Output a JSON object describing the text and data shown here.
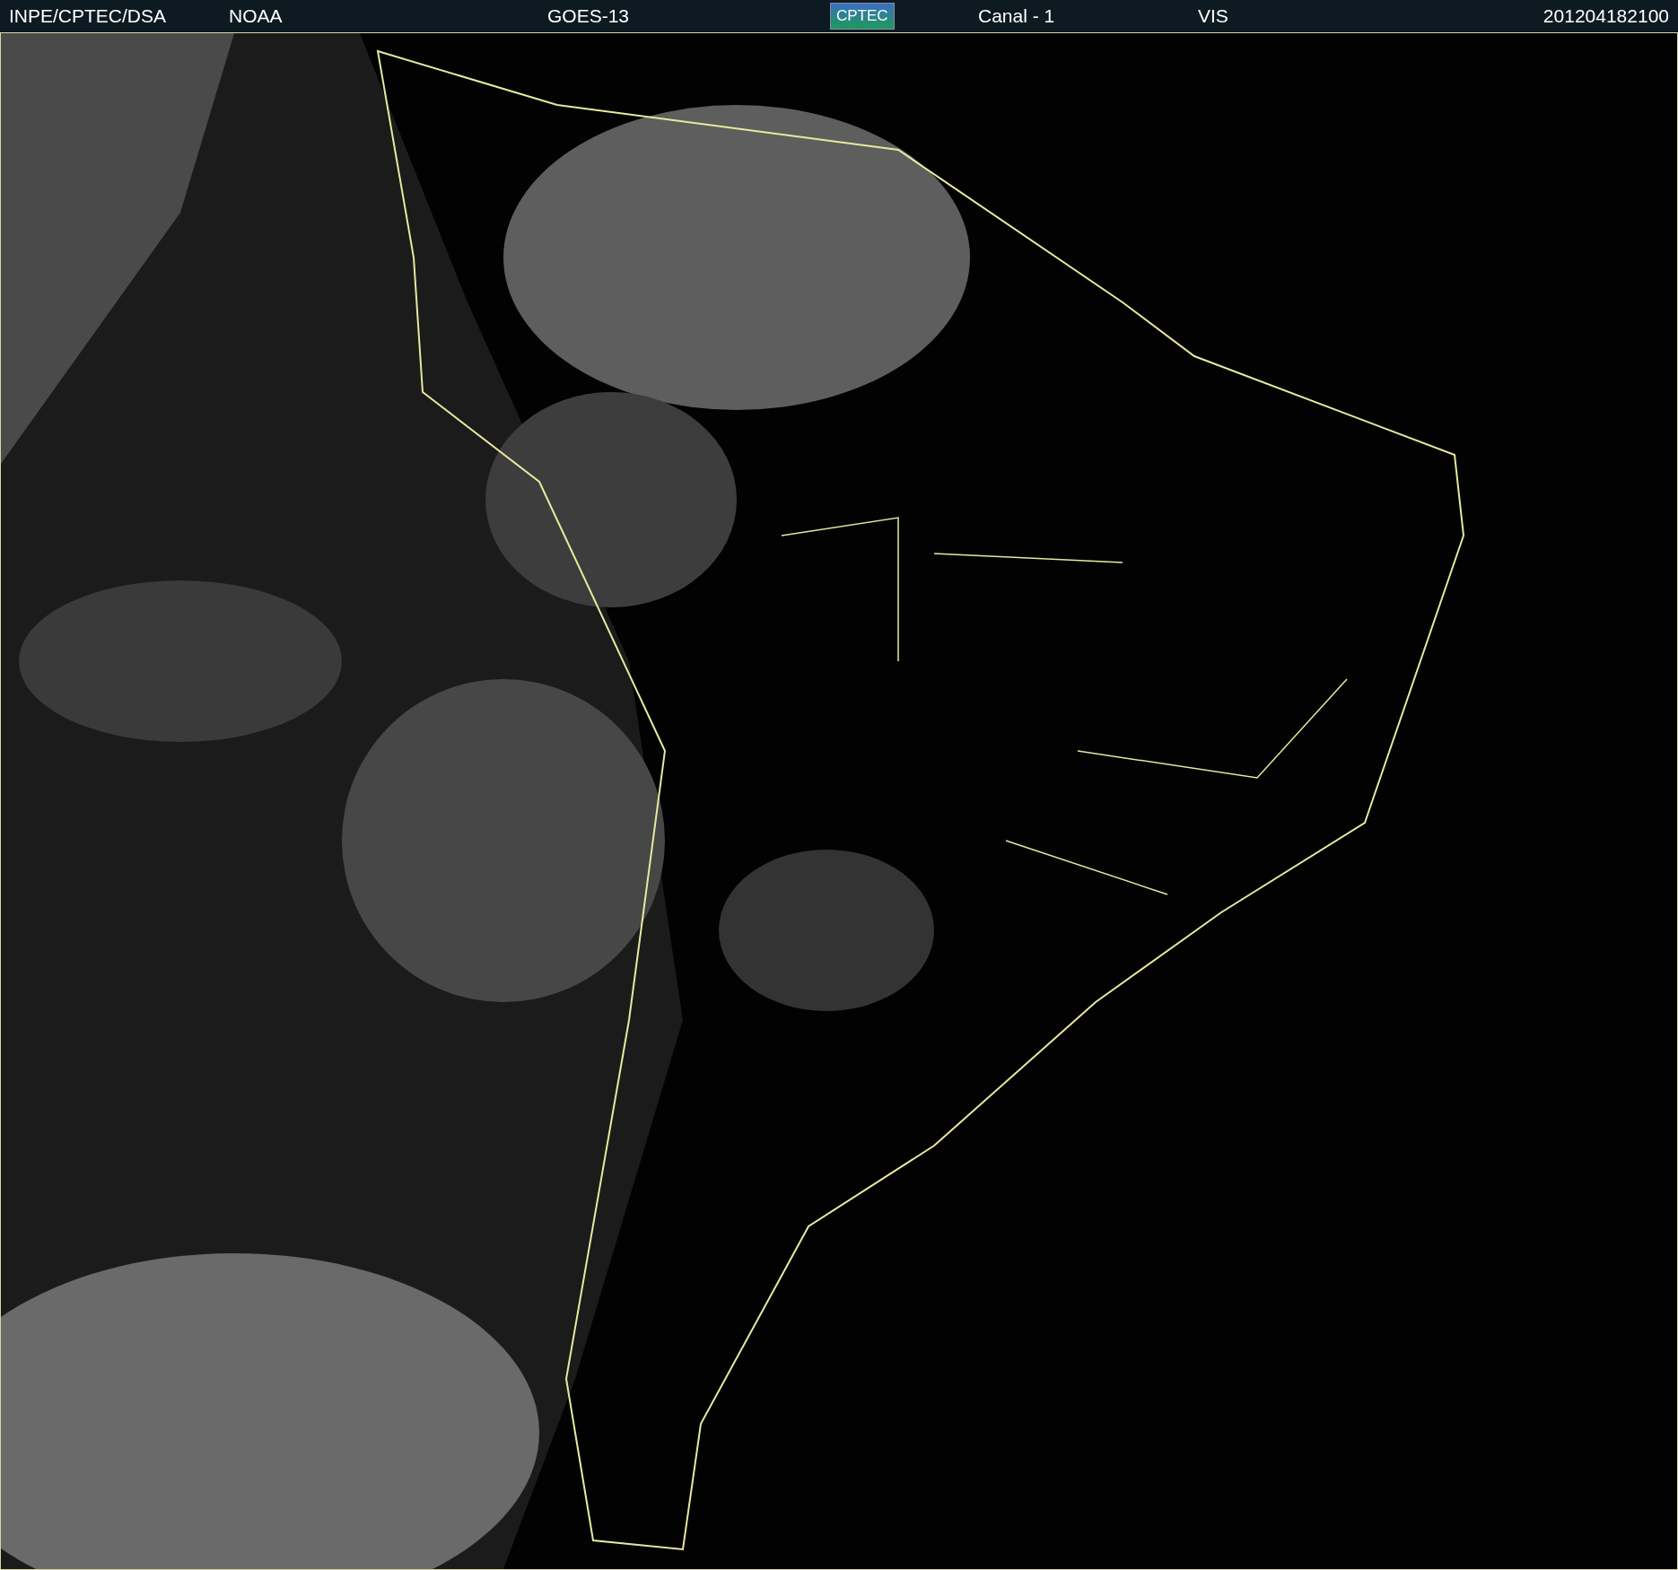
{
  "header": {
    "source": "INPE/CPTEC/DSA",
    "agency": "NOAA",
    "satellite": "GOES-13",
    "logo": "CPTEC",
    "channel": "Canal - 1",
    "band": "VIS",
    "timestamp": "201204182100"
  }
}
